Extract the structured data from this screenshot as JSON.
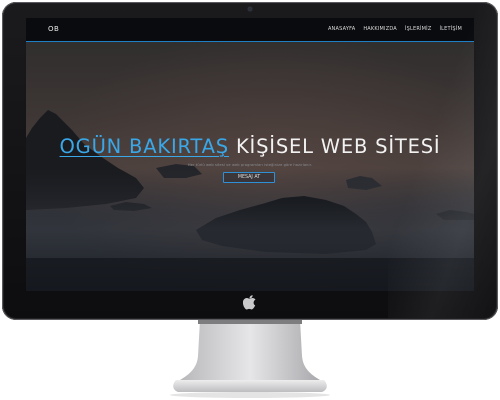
{
  "site": {
    "brand": "OB",
    "nav": [
      "ANASAYFA",
      "HAKKIMIZDA",
      "İŞLERİMİZ",
      "İLETİŞİM"
    ]
  },
  "hero": {
    "name": "OGÜN BAKIRTAŞ",
    "rest": " KİŞİSEL WEB SİTESİ",
    "subtitle": "Her türlü web sitesi ve web programları isteğinize göre hazırlanır.",
    "button": "MESAJ AT"
  },
  "colors": {
    "accent": "#3aa7e8",
    "nav_border": "#1f7fc4",
    "monitor": "#121214"
  },
  "icons": {
    "chin_logo": "apple-logo-icon"
  }
}
